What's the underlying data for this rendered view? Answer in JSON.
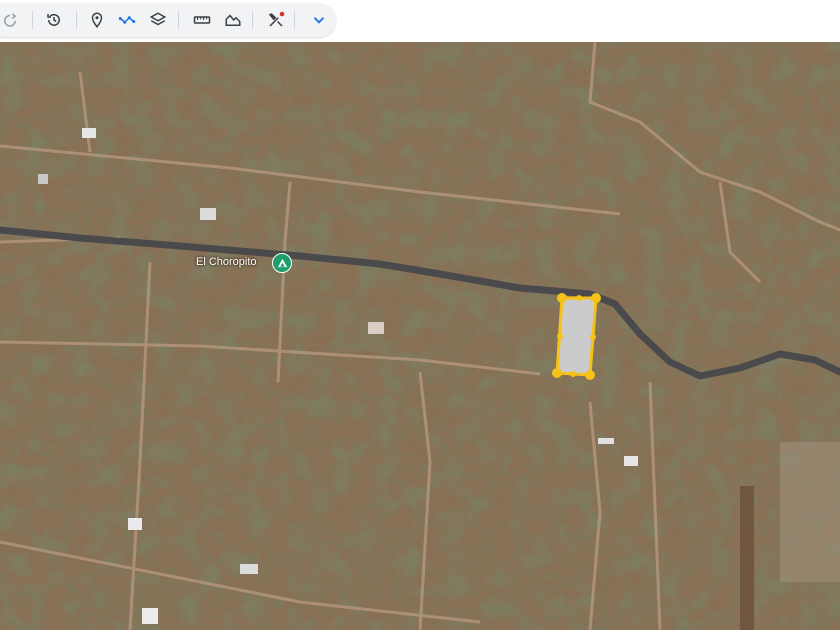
{
  "toolbar": {
    "buttons": [
      {
        "name": "redo",
        "icon": "redo-icon"
      },
      {
        "name": "historical-imagery",
        "icon": "history-icon"
      },
      {
        "name": "add-placemark",
        "icon": "placemark-icon"
      },
      {
        "name": "add-path",
        "icon": "path-icon"
      },
      {
        "name": "layers",
        "icon": "layers-icon"
      },
      {
        "name": "measure",
        "icon": "ruler-icon"
      },
      {
        "name": "elevation-profile",
        "icon": "elevation-icon"
      },
      {
        "name": "tools",
        "icon": "tools-icon"
      },
      {
        "name": "more",
        "icon": "chevron-down-icon"
      }
    ],
    "accent_color": "#1a73e8",
    "notification_color": "#d93025"
  },
  "map": {
    "place": {
      "label": "El Choropito",
      "marker_color": "#1e9e6a"
    },
    "polygon": {
      "stroke_color": "#f6c21a",
      "fill_color": "#d7dbe0"
    }
  }
}
